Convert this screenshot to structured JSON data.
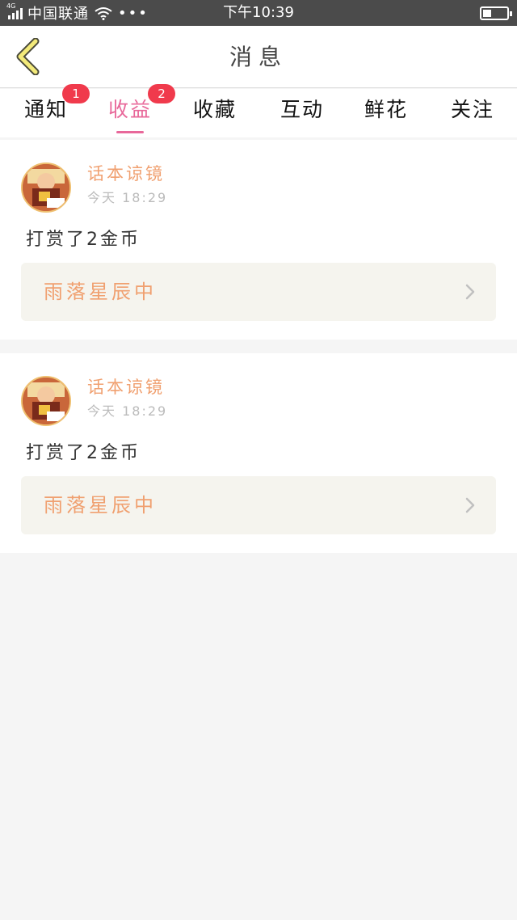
{
  "status_bar": {
    "network": "4G",
    "carrier": "中国联通",
    "more": "•••",
    "time": "下午10:39",
    "battery_level": 0.35
  },
  "header": {
    "title": "消息"
  },
  "tabs": [
    {
      "label": "通知",
      "badge": "1",
      "active": false
    },
    {
      "label": "收益",
      "badge": "2",
      "active": true
    },
    {
      "label": "收藏",
      "active": false
    },
    {
      "label": "互动",
      "active": false
    },
    {
      "label": "鲜花",
      "active": false
    },
    {
      "label": "关注",
      "active": false
    }
  ],
  "messages": [
    {
      "sender": "话本谅镜",
      "time": "今天 18:29",
      "text": "打赏了2金币",
      "link": "雨落星辰中"
    },
    {
      "sender": "话本谅镜",
      "time": "今天 18:29",
      "text": "打赏了2金币",
      "link": "雨落星辰中"
    }
  ],
  "colors": {
    "accent": "#e8689a",
    "badge": "#f03a4c",
    "status_bar": "#4b4b4b",
    "sender": "#f0a070",
    "link_box": "#f5f4ee"
  }
}
